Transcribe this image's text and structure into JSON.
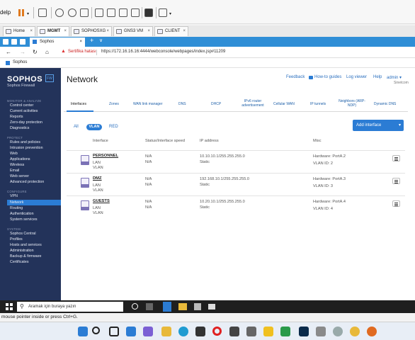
{
  "vm": {
    "menu_help": "delp",
    "tabs": [
      {
        "label": "Home"
      },
      {
        "label": "MGMT"
      },
      {
        "label": "SOPHOSXG"
      },
      {
        "label": "GNS3 VM"
      },
      {
        "label": "CLIENT"
      }
    ],
    "status_text": "mouse pointer inside or press Ctrl+G."
  },
  "browser": {
    "tab_title": "Sophos",
    "new_tab": "+",
    "security_warning": "Sertifika hatası",
    "url": "https://172.16.16.16:4444/webconsole/webpages/index.jsp#11209",
    "favorite": "Sophos"
  },
  "sidebar": {
    "brand": "SOPHOS",
    "brand_sub": "Sophos Firewall",
    "brand_badge": "FW",
    "sections": [
      {
        "header": "MONITOR & ANALYZE",
        "items": [
          "Control center",
          "Current activities",
          "Reports",
          "Zero-day protection",
          "Diagnostics"
        ]
      },
      {
        "header": "PROTECT",
        "items": [
          "Rules and policies",
          "Intrusion prevention",
          "Web",
          "Applications",
          "Wireless",
          "Email",
          "Web server",
          "Advanced protection"
        ]
      },
      {
        "header": "CONFIGURE",
        "items": [
          "VPN",
          "Network",
          "Routing",
          "Authentication",
          "System services"
        ]
      },
      {
        "header": "SYSTEM",
        "items": [
          "Sophos Central",
          "Profiles",
          "Hosts and services",
          "Administration",
          "Backup & firmware",
          "Certificates"
        ]
      }
    ],
    "active_item": "Network"
  },
  "header": {
    "title": "Network",
    "links": {
      "feedback": "Feedback",
      "howto": "How-to guides",
      "log": "Log viewer",
      "help": "Help",
      "admin": "admin",
      "admin_sub": "Sinetcom"
    }
  },
  "subtabs": [
    "Interfaces",
    "Zones",
    "WAN link manager",
    "DNS",
    "DHCP",
    "IPv6 router advertisement",
    "Cellular WAN",
    "IP tunnels",
    "Neighbors (ARP-NDP)",
    "Dynamic DNS"
  ],
  "filters": {
    "all": "All",
    "vlan": "VLAN",
    "red": "RED"
  },
  "add_button": "Add interface",
  "columns": {
    "interface": "Interface",
    "status": "Status/Interface speed",
    "ip": "IP address",
    "misc": "Misc"
  },
  "rows": [
    {
      "name": "PERSONNEL",
      "zone": "LAN",
      "type": "VLAN",
      "status1": "N/A",
      "status2": "N/A",
      "ip": "10.10.10.1/255.255.255.0",
      "ip_mode": "Static",
      "hardware": "Hardware:  PortA.2",
      "vlan_id": "VLAN ID: 2"
    },
    {
      "name": "DMZ",
      "zone": "LAN",
      "type": "VLAN",
      "status1": "N/A",
      "status2": "N/A",
      "ip": "192.168.10.1/255.255.255.0",
      "ip_mode": "Static",
      "hardware": "Hardware:  PortA.3",
      "vlan_id": "VLAN ID: 3"
    },
    {
      "name": "GUESTS",
      "zone": "LAN",
      "type": "VLAN",
      "status1": "N/A",
      "status2": "N/A",
      "ip": "10.20.10.1/255.255.255.0",
      "ip_mode": "Static",
      "hardware": "Hardware:  PortA.4",
      "vlan_id": "VLAN ID: 4"
    }
  ],
  "taskbar": {
    "search_placeholder": "Aramak için buraya yazın"
  }
}
